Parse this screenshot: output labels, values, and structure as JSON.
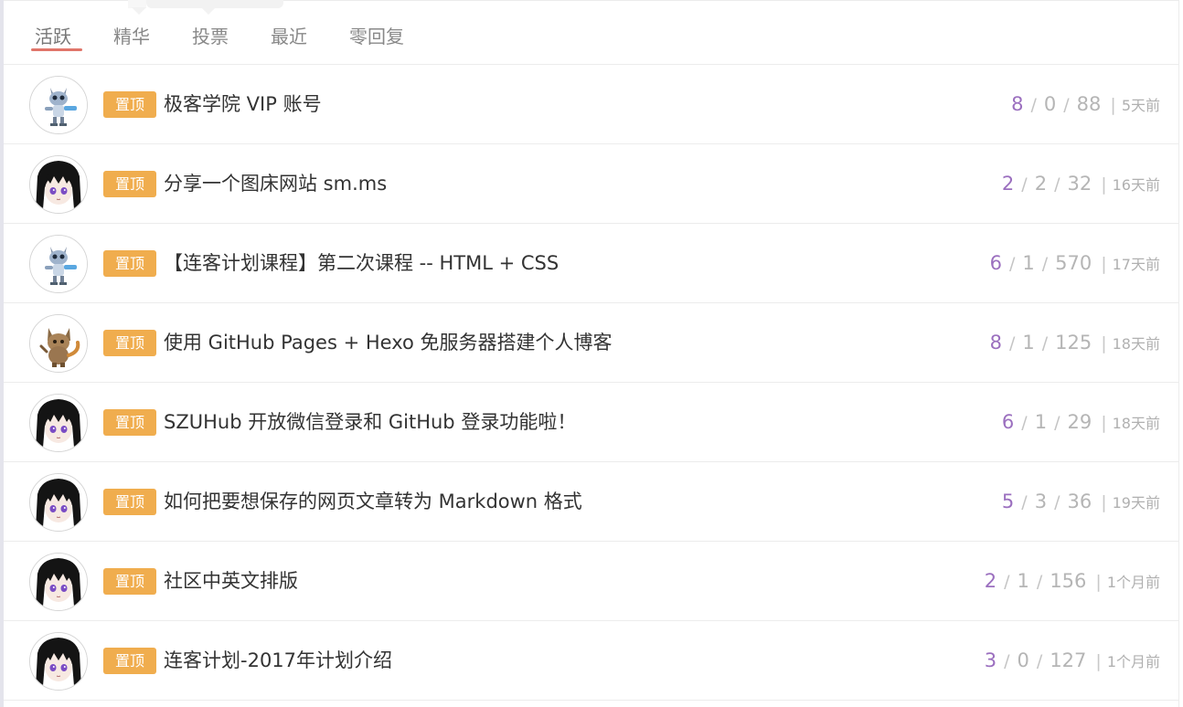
{
  "tabs": [
    {
      "label": "活跃",
      "active": true
    },
    {
      "label": "精华",
      "active": false
    },
    {
      "label": "投票",
      "active": false
    },
    {
      "label": "最近",
      "active": false
    },
    {
      "label": "零回复",
      "active": false
    }
  ],
  "pin_label": "置顶",
  "colors": {
    "pin_badge": "#f0ad4e",
    "likes": "#9b6fbf",
    "active_tab_underline": "#e0756a"
  },
  "topics": [
    {
      "avatar": "robot-avatar",
      "title": "极客学院 VIP 账号",
      "likes": "8",
      "replies": "0",
      "views": "88",
      "time": "5天前"
    },
    {
      "avatar": "anime-avatar",
      "title": "分享一个图床网站 sm.ms",
      "likes": "2",
      "replies": "2",
      "views": "32",
      "time": "16天前"
    },
    {
      "avatar": "robot-avatar",
      "title": "【连客计划课程】第二次课程 -- HTML + CSS",
      "likes": "6",
      "replies": "1",
      "views": "570",
      "time": "17天前"
    },
    {
      "avatar": "cat-avatar",
      "title": "使用 GitHub Pages + Hexo 免服务器搭建个人博客",
      "likes": "8",
      "replies": "1",
      "views": "125",
      "time": "18天前"
    },
    {
      "avatar": "anime-avatar",
      "title": "SZUHub 开放微信登录和 GitHub 登录功能啦！",
      "likes": "6",
      "replies": "1",
      "views": "29",
      "time": "18天前"
    },
    {
      "avatar": "anime-avatar",
      "title": "如何把要想保存的网页文章转为 Markdown 格式",
      "likes": "5",
      "replies": "3",
      "views": "36",
      "time": "19天前"
    },
    {
      "avatar": "anime-avatar",
      "title": "社区中英文排版",
      "likes": "2",
      "replies": "1",
      "views": "156",
      "time": "1个月前"
    },
    {
      "avatar": "anime-avatar",
      "title": "连客计划-2017年计划介绍",
      "likes": "3",
      "replies": "0",
      "views": "127",
      "time": "1个月前"
    }
  ]
}
